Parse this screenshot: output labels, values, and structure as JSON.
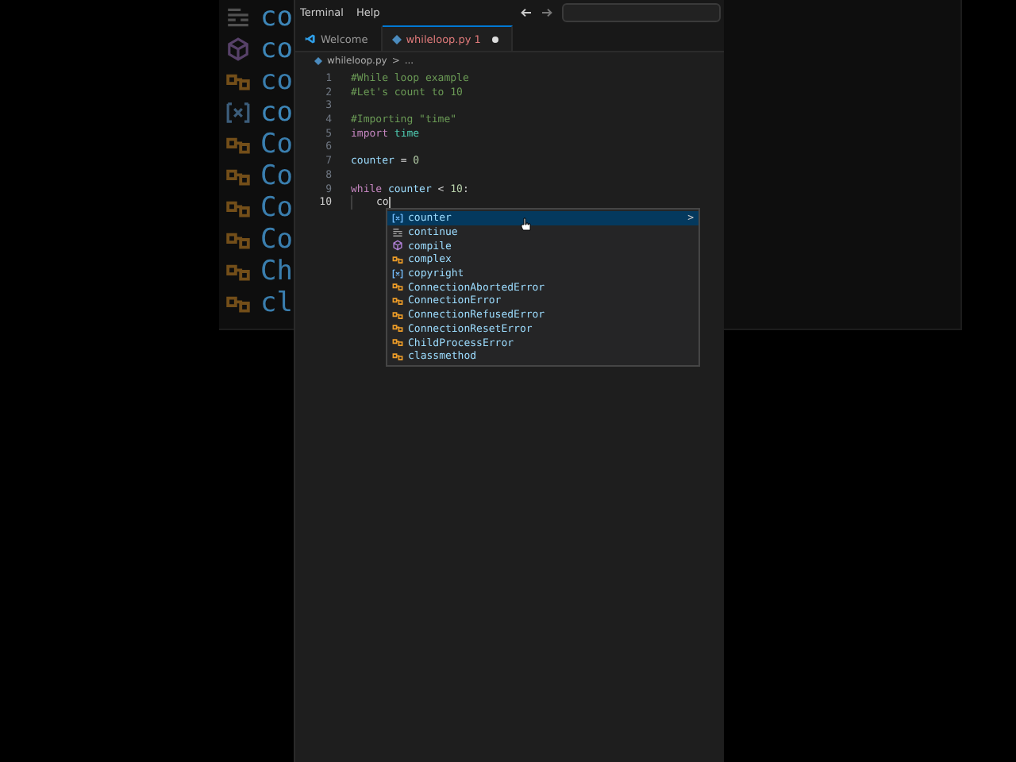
{
  "backdrop": {
    "rows": [
      {
        "kind": "keyword",
        "text": "co"
      },
      {
        "kind": "function",
        "text": "co"
      },
      {
        "kind": "class",
        "text": "co"
      },
      {
        "kind": "variable",
        "text": "co"
      },
      {
        "kind": "class",
        "text": "Co"
      },
      {
        "kind": "class",
        "text": "Co"
      },
      {
        "kind": "class",
        "text": "Co"
      },
      {
        "kind": "class",
        "text": "Co"
      },
      {
        "kind": "class",
        "text": "Ch"
      },
      {
        "kind": "class",
        "text": "cl"
      }
    ]
  },
  "menu": [
    "Terminal",
    "Help"
  ],
  "tabs": [
    {
      "kind": "welcome",
      "label": "Welcome",
      "selected": false,
      "modified": false
    },
    {
      "kind": "python",
      "label": "whileloop.py",
      "problems": "1",
      "selected": true,
      "modified": true
    }
  ],
  "breadcrumb": {
    "file": "whileloop.py",
    "separator": ">",
    "rest": "..."
  },
  "code": [
    {
      "number": "1",
      "active": false,
      "indent": false,
      "tokens": [
        {
          "kind": "comment",
          "text": "#While loop example"
        }
      ]
    },
    {
      "number": "2",
      "active": false,
      "indent": false,
      "tokens": [
        {
          "kind": "comment",
          "text": "#Let's count to 10"
        }
      ]
    },
    {
      "number": "3",
      "active": false,
      "indent": false
    },
    {
      "number": "4",
      "active": false,
      "indent": false,
      "tokens": [
        {
          "kind": "comment",
          "text": "#Importing \"time\""
        }
      ]
    },
    {
      "number": "5",
      "active": false,
      "indent": false,
      "tokens": [
        {
          "kind": "keyword",
          "text": "import "
        },
        {
          "kind": "module",
          "text": "time"
        }
      ]
    },
    {
      "number": "6",
      "active": false,
      "indent": false
    },
    {
      "number": "7",
      "active": false,
      "indent": false,
      "tokens": [
        {
          "kind": "variable",
          "text": "counter"
        },
        {
          "kind": "plain",
          "text": " = "
        },
        {
          "kind": "number",
          "text": "0"
        }
      ]
    },
    {
      "number": "8",
      "active": false,
      "indent": false
    },
    {
      "number": "9",
      "active": false,
      "indent": false,
      "tokens": [
        {
          "kind": "keyword",
          "text": "while "
        },
        {
          "kind": "variable",
          "text": "counter"
        },
        {
          "kind": "plain",
          "text": " < "
        },
        {
          "kind": "number",
          "text": "10"
        },
        {
          "kind": "plain",
          "text": ":"
        }
      ]
    },
    {
      "number": "10",
      "active": true,
      "indent": true,
      "tokens": [
        {
          "kind": "plain",
          "text": "co"
        }
      ]
    }
  ],
  "suggestions": [
    {
      "kind": "variable",
      "label": "counter",
      "selected": true,
      "chevron": ">"
    },
    {
      "kind": "keyword",
      "label": "continue",
      "selected": false
    },
    {
      "kind": "function",
      "label": "compile",
      "selected": false
    },
    {
      "kind": "class",
      "label": "complex",
      "selected": false
    },
    {
      "kind": "variable",
      "label": "copyright",
      "selected": false
    },
    {
      "kind": "class",
      "label": "ConnectionAbortedError",
      "selected": false
    },
    {
      "kind": "class",
      "label": "ConnectionError",
      "selected": false
    },
    {
      "kind": "class",
      "label": "ConnectionRefusedError",
      "selected": false
    },
    {
      "kind": "class",
      "label": "ConnectionResetError",
      "selected": false
    },
    {
      "kind": "class",
      "label": "ChildProcessError",
      "selected": false
    },
    {
      "kind": "class",
      "label": "classmethod",
      "selected": false
    }
  ]
}
